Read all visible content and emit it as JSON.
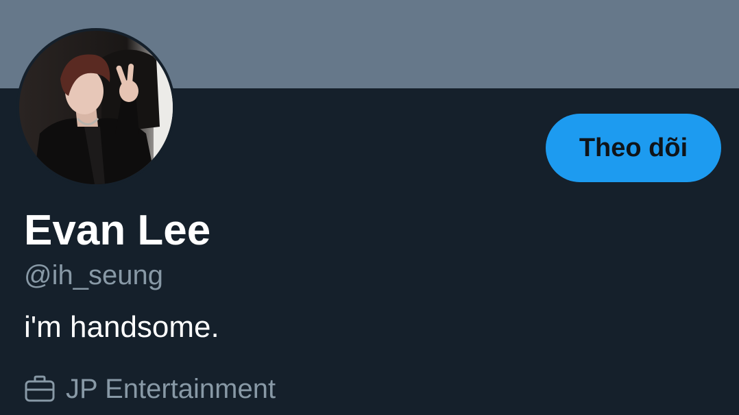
{
  "profile": {
    "display_name": "Evan Lee",
    "handle": "@ih_seung",
    "bio": "i'm handsome.",
    "work": "JP Entertainment",
    "work_icon": "briefcase-icon",
    "avatar_icon": "avatar-photo"
  },
  "actions": {
    "follow_label": "Theo dõi"
  },
  "colors": {
    "banner": "#66788a",
    "background": "#15202b",
    "accent": "#1d9bf0",
    "secondary_text": "#8899a6"
  }
}
